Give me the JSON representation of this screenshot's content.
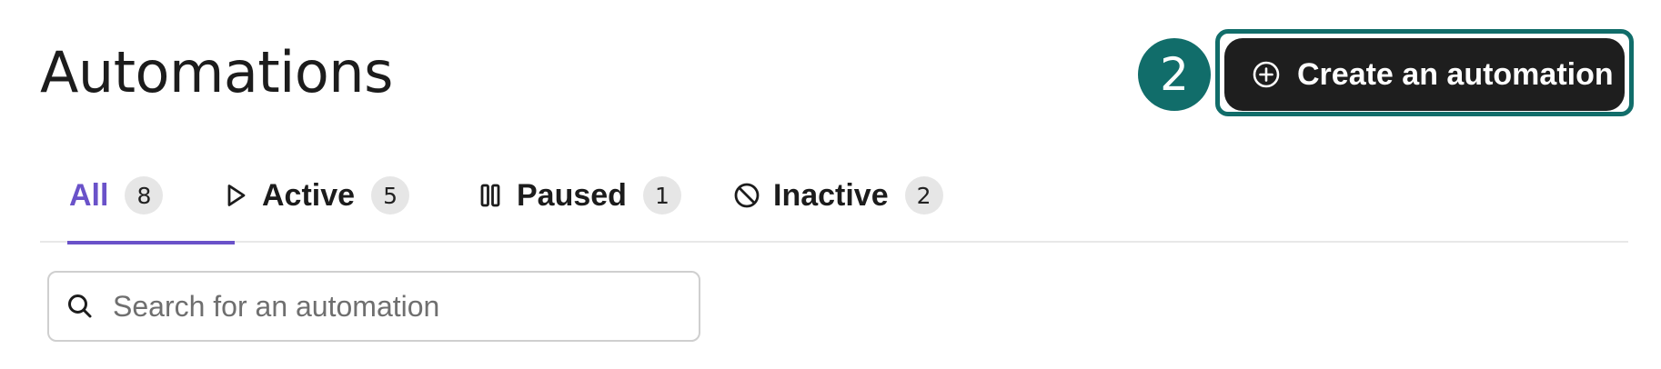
{
  "header": {
    "title": "Automations",
    "step_number": "2",
    "create_label": "Create an automation"
  },
  "tabs": [
    {
      "label": "All",
      "count": "8",
      "icon": "none",
      "selected": true
    },
    {
      "label": "Active",
      "count": "5",
      "icon": "play-icon",
      "selected": false
    },
    {
      "label": "Paused",
      "count": "1",
      "icon": "pause-icon",
      "selected": false
    },
    {
      "label": "Inactive",
      "count": "2",
      "icon": "ban-icon",
      "selected": false
    }
  ],
  "search": {
    "placeholder": "Search for an automation",
    "value": ""
  },
  "colors": {
    "accent": "#6a52c9",
    "highlight": "#116d6a",
    "button_bg": "#1e1e1e"
  }
}
